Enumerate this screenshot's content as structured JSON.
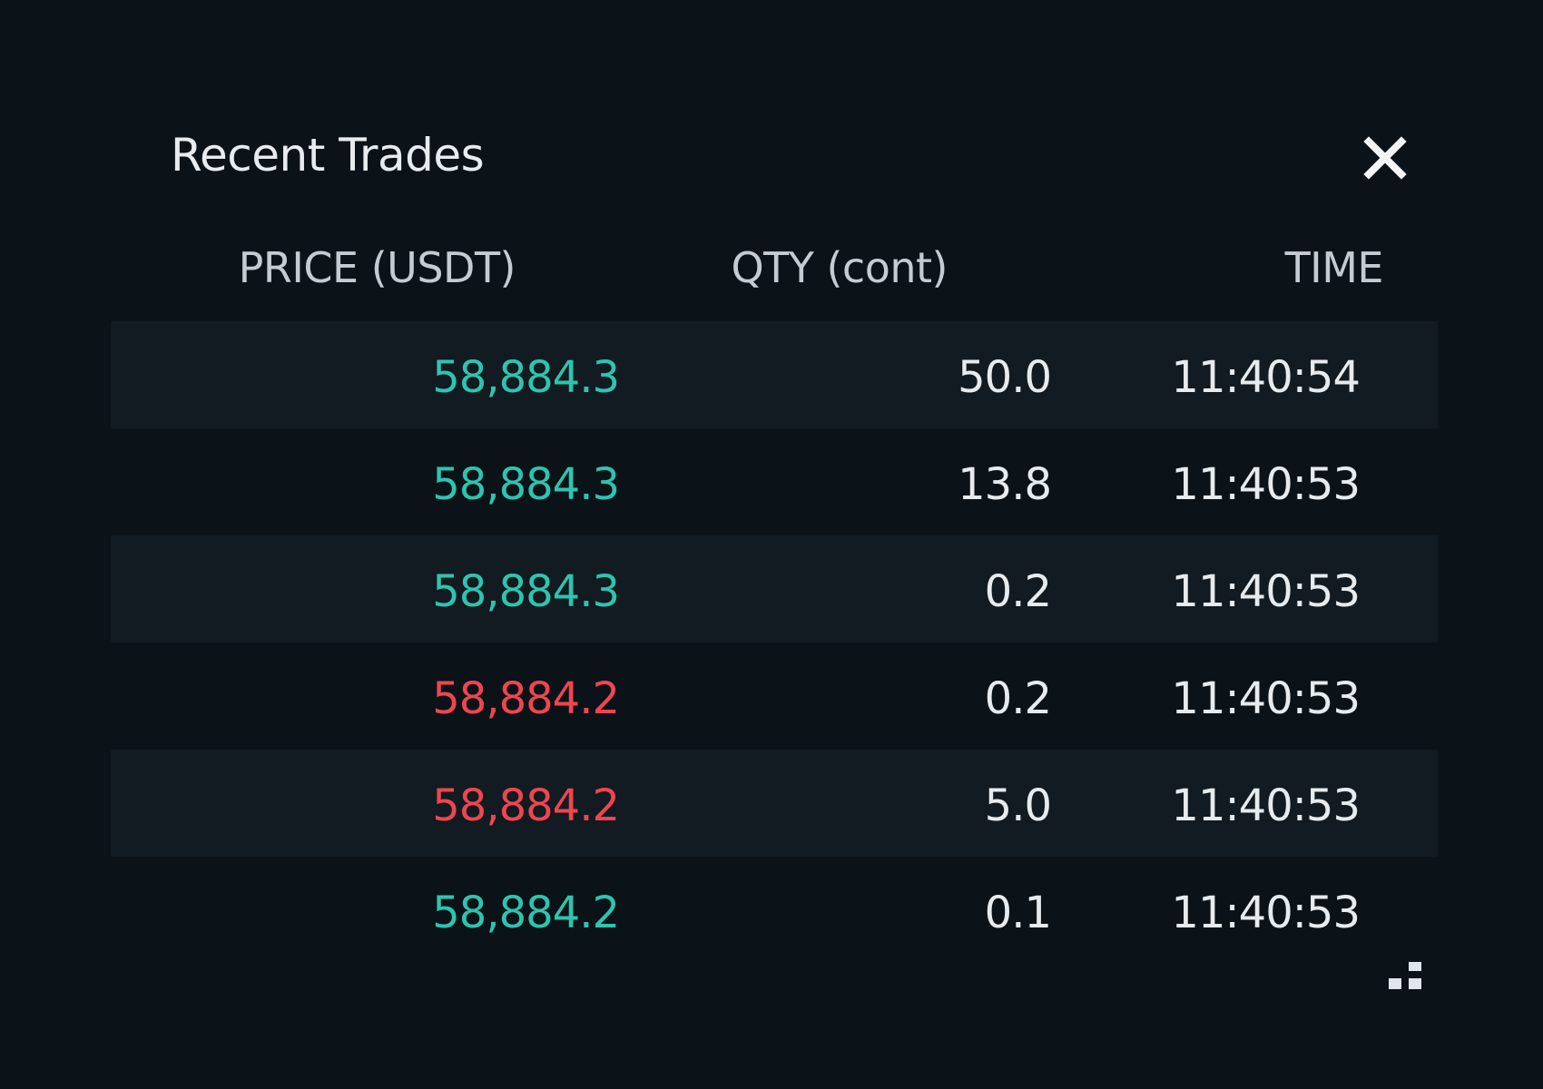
{
  "panel": {
    "title": "Recent Trades",
    "close_icon": "close-icon",
    "resize_icon": "resize-grip-icon"
  },
  "columns": {
    "price": "PRICE (USDT)",
    "qty": "QTY (cont)",
    "time": "TIME"
  },
  "colors": {
    "buy": "#2ec4ad",
    "sell": "#f0454f",
    "text": "#e7ebee",
    "header": "#c4cbd2",
    "background": "#0b1319",
    "stripe": "#111b21"
  },
  "trades": [
    {
      "price": "58,884.3",
      "qty": "50.0",
      "time": "11:40:54",
      "side": "buy"
    },
    {
      "price": "58,884.3",
      "qty": "13.8",
      "time": "11:40:53",
      "side": "buy"
    },
    {
      "price": "58,884.3",
      "qty": "0.2",
      "time": "11:40:53",
      "side": "buy"
    },
    {
      "price": "58,884.2",
      "qty": "0.2",
      "time": "11:40:53",
      "side": "sell"
    },
    {
      "price": "58,884.2",
      "qty": "5.0",
      "time": "11:40:53",
      "side": "sell"
    },
    {
      "price": "58,884.2",
      "qty": "0.1",
      "time": "11:40:53",
      "side": "buy"
    }
  ]
}
